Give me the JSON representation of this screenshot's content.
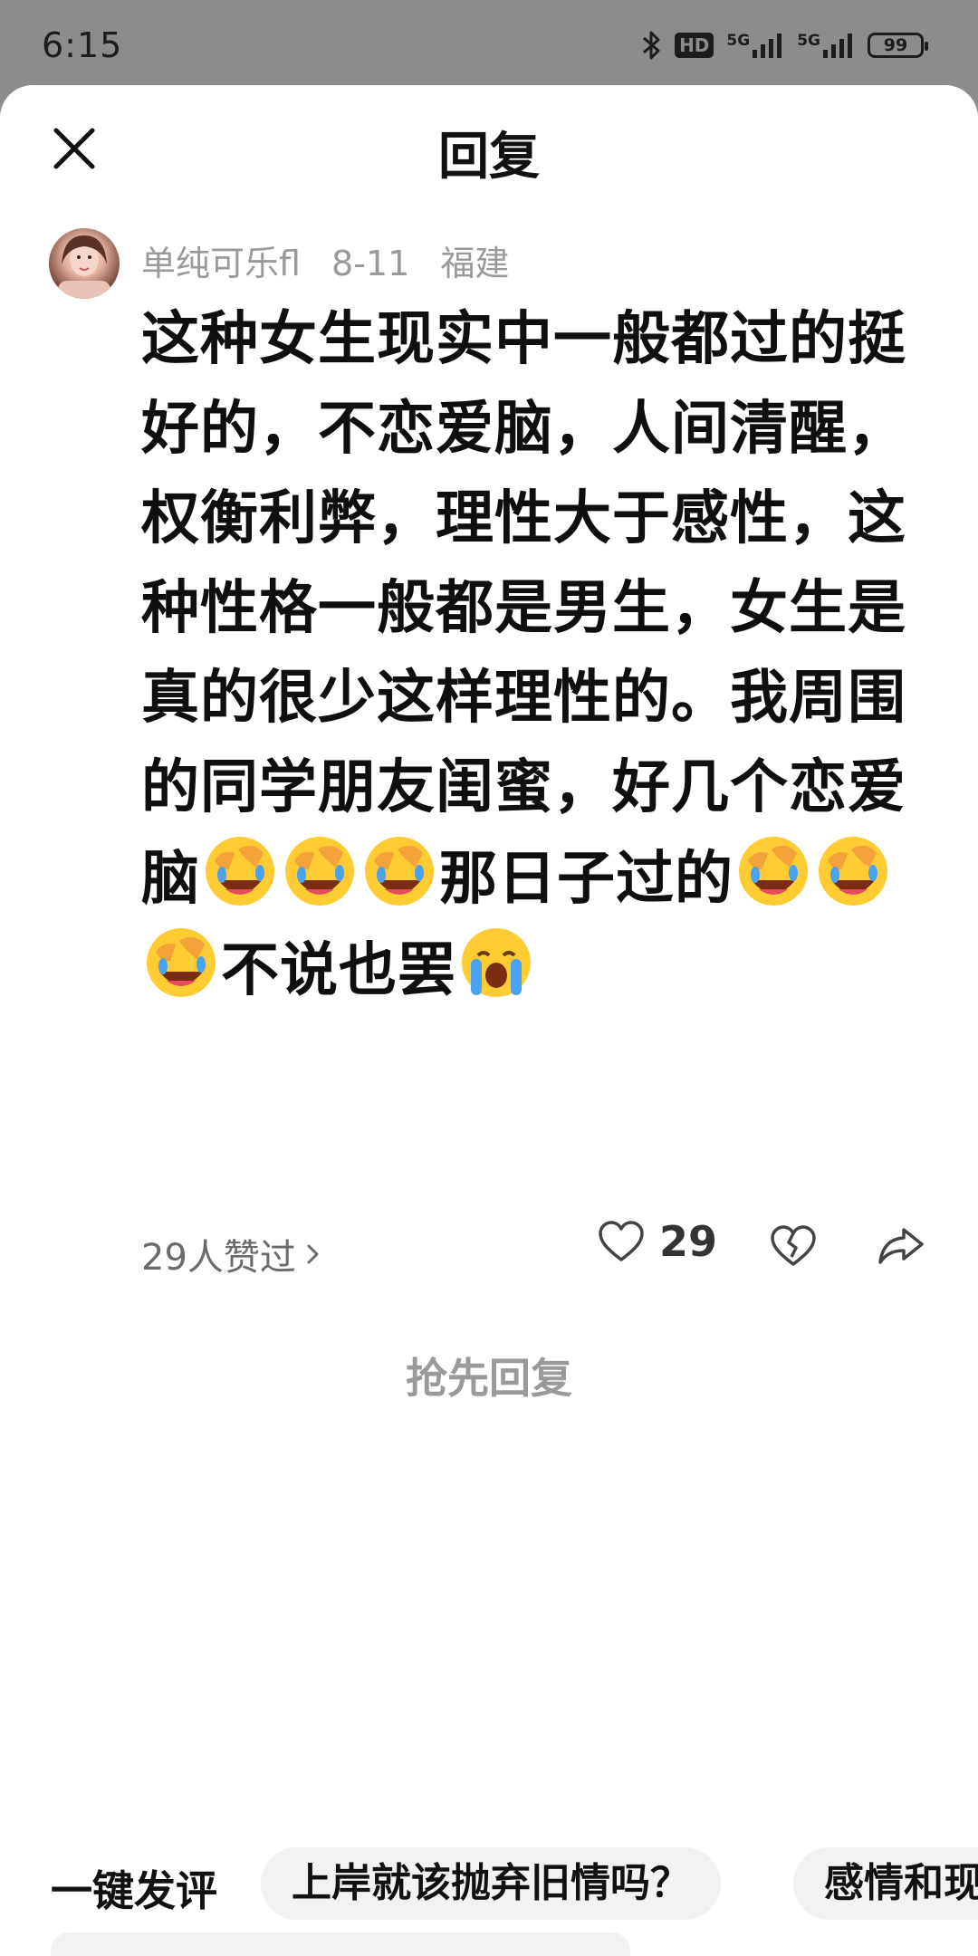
{
  "status_bar": {
    "time": "6:15",
    "hd_label": "HD",
    "network_1": "5G",
    "network_2": "5G",
    "battery": "99",
    "icons": [
      "bluetooth-icon",
      "hd-icon",
      "signal-icon",
      "signal-icon",
      "battery-icon"
    ]
  },
  "header": {
    "title": "回复",
    "close_icon": "close-icon"
  },
  "comment": {
    "author": "单纯可乐fl",
    "date": "8-11",
    "location": "福建",
    "segments": [
      {
        "type": "text",
        "value": "这种女生现实中一般都过的挺好的，不恋爱脑，人间清醒，权衡利弊，理性大于感性，这种性格一般都是男生，女生是真的很少这样理性的。我周围的同学朋友闺蜜，好几个恋爱脑"
      },
      {
        "type": "emoji",
        "name": "facepalm-laugh-emoji"
      },
      {
        "type": "emoji",
        "name": "facepalm-laugh-emoji"
      },
      {
        "type": "emoji",
        "name": "facepalm-laugh-emoji"
      },
      {
        "type": "text",
        "value": "那日子过的"
      },
      {
        "type": "emoji",
        "name": "facepalm-laugh-emoji"
      },
      {
        "type": "emoji",
        "name": "facepalm-laugh-emoji"
      },
      {
        "type": "emoji",
        "name": "facepalm-laugh-emoji"
      },
      {
        "type": "text",
        "value": "不说也罢"
      },
      {
        "type": "emoji",
        "name": "loudly-crying-emoji"
      }
    ],
    "likers_text": "29人赞过",
    "like_count": "29"
  },
  "first_reply_label": "抢先回复",
  "quick_comment": {
    "label": "一键发评",
    "chips": [
      "上岸就该抛弃旧情吗？",
      "感情和现"
    ]
  },
  "colors": {
    "status_bar_bg": "#8c8c8c",
    "sheet_bg": "#ffffff",
    "muted_text": "#9a9a9a",
    "chip_bg": "#f2f2f2"
  }
}
